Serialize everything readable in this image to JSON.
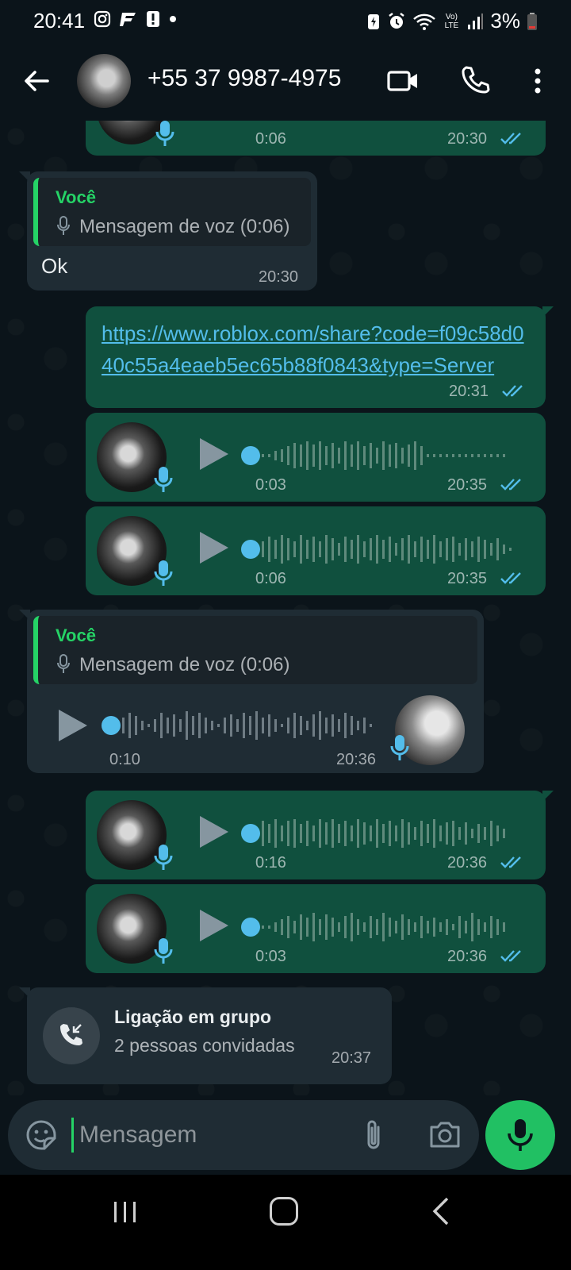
{
  "status_bar": {
    "time": "20:41",
    "battery": "3%",
    "network": "Vo) LTE",
    "icons": [
      "instagram-icon",
      "f-app-icon",
      "alert-icon",
      "dot-icon",
      "battery-saver-icon",
      "alarm-icon",
      "wifi-icon",
      "signal-icon",
      "battery-low-icon"
    ]
  },
  "header": {
    "contact": "+55 37 9987-4975",
    "icons": [
      "back-arrow-icon",
      "video-call-icon",
      "voice-call-icon",
      "more-vert-icon"
    ]
  },
  "messages": [
    {
      "type": "voice",
      "direction": "out",
      "duration": "0:06",
      "time": "20:30",
      "read": true
    },
    {
      "type": "reply",
      "direction": "in",
      "quote_name": "Você",
      "quote_text": "Mensagem de voz (0:06)",
      "text": "Ok",
      "time": "20:30"
    },
    {
      "type": "link",
      "direction": "out",
      "text": "https://www.roblox.com/share?code=f09c58d040c55a4eaeb5ec65b88f0843&type=Server",
      "time": "20:31",
      "read": true
    },
    {
      "type": "voice",
      "direction": "out",
      "duration": "0:03",
      "time": "20:35",
      "read": true
    },
    {
      "type": "voice",
      "direction": "out",
      "duration": "0:06",
      "time": "20:35",
      "read": true
    },
    {
      "type": "reply-voice",
      "direction": "in",
      "quote_name": "Você",
      "quote_text": "Mensagem de voz (0:06)",
      "duration": "0:10",
      "time": "20:36"
    },
    {
      "type": "voice",
      "direction": "out",
      "duration": "0:16",
      "time": "20:36",
      "read": true
    },
    {
      "type": "voice",
      "direction": "out",
      "duration": "0:03",
      "time": "20:36",
      "read": true
    }
  ],
  "call_card": {
    "title": "Ligação em grupo",
    "subtitle": "2 pessoas convidadas",
    "time": "20:37"
  },
  "composer": {
    "placeholder": "Mensagem"
  },
  "colors": {
    "background": "#0b141a",
    "outgoing_bubble": "#10503e",
    "incoming_bubble": "#1f2c34",
    "accent_green": "#25d366",
    "link_blue": "#53bdeb",
    "mic_button": "#21c063"
  }
}
